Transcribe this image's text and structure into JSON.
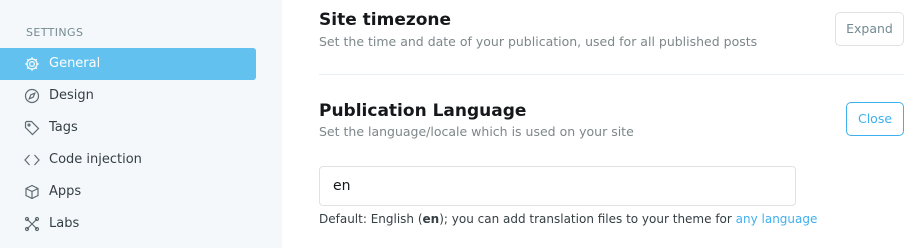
{
  "sidebar": {
    "heading": "SETTINGS",
    "items": [
      {
        "label": "General",
        "icon": "gear-icon",
        "active": true
      },
      {
        "label": "Design",
        "icon": "compass-icon",
        "active": false
      },
      {
        "label": "Tags",
        "icon": "tag-icon",
        "active": false
      },
      {
        "label": "Code injection",
        "icon": "code-icon",
        "active": false
      },
      {
        "label": "Apps",
        "icon": "box-icon",
        "active": false
      },
      {
        "label": "Labs",
        "icon": "flask-icon",
        "active": false
      }
    ]
  },
  "timezone": {
    "title": "Site timezone",
    "description": "Set the time and date of your publication, used for all published posts",
    "button_label": "Expand"
  },
  "language": {
    "title": "Publication Language",
    "description": "Set the language/locale which is used on your site",
    "button_label": "Close",
    "input_value": "en",
    "hint_prefix": "Default: English (",
    "hint_code": "en",
    "hint_middle": "); you can add translation files to your theme for ",
    "hint_link": "any language"
  },
  "colors": {
    "accent": "#3eb0ef",
    "sidebar_active": "#62c1ef",
    "sidebar_bg": "#f4f8fb"
  }
}
